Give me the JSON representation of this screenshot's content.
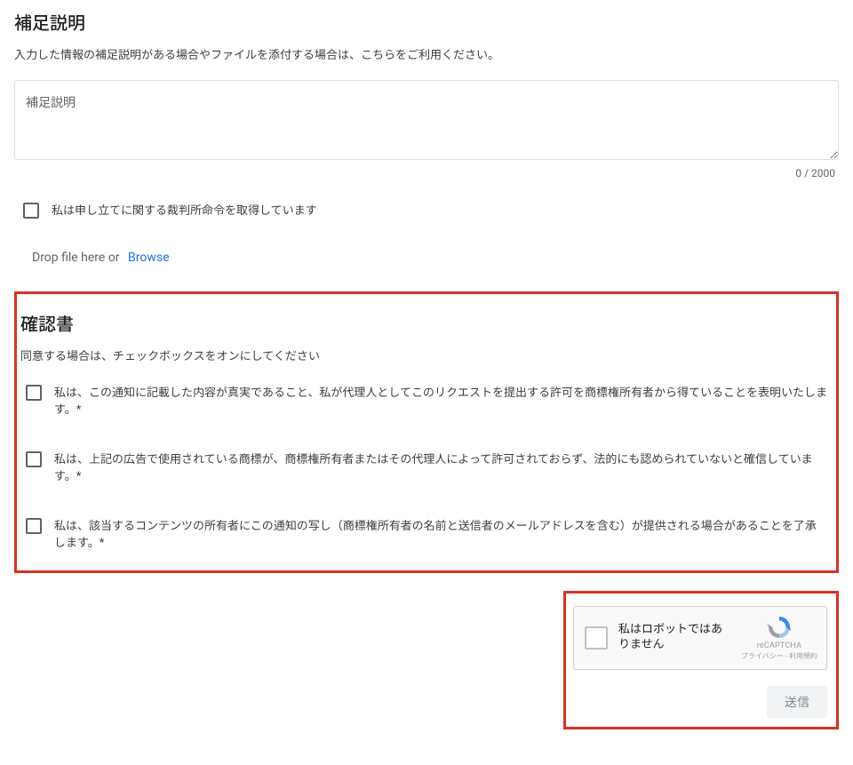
{
  "supplement": {
    "title": "補足説明",
    "description": "入力した情報の補足説明がある場合やファイルを添付する場合は、こちらをご利用ください。",
    "placeholder": "補足説明",
    "charcount": "0 / 2000",
    "court_order_checkbox": "私は申し立てに関する裁判所命令を取得しています",
    "drop_text": "Drop file here or",
    "browse_text": "Browse"
  },
  "confirmation": {
    "title": "確認書",
    "description": "同意する場合は、チェックボックスをオンにしてください",
    "items": [
      "私は、この通知に記載した内容が真実であること、私が代理人としてこのリクエストを提出する許可を商標権所有者から得ていることを表明いたします。*",
      "私は、上記の広告で使用されている商標が、商標権所有者またはその代理人によって許可されておらず、法的にも認められていないと確信しています。*",
      "私は、該当するコンテンツの所有者にこの通知の写し（商標権所有者の名前と送信者のメールアドレスを含む）が提供される場合があることを了承します。*"
    ]
  },
  "recaptcha": {
    "text": "私はロボットではありません",
    "brand": "reCAPTCHA",
    "terms": "プライバシー - 利用規約"
  },
  "submit": "送信"
}
